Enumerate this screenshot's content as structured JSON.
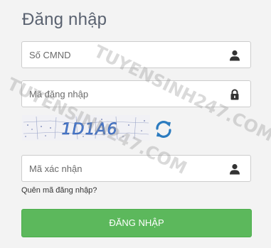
{
  "title": "Đăng nhập",
  "cmnd_field": {
    "placeholder": "Số CMND",
    "icon": "user-icon"
  },
  "password_field": {
    "placeholder": "Mã đăng nhập",
    "icon": "lock-icon"
  },
  "captcha": {
    "text": "1D1A6",
    "refresh_icon": "refresh-icon"
  },
  "captcha_field": {
    "placeholder": "Mã xác nhận",
    "icon": "user-icon"
  },
  "forgot_link": "Quên mã đăng nhập?",
  "login_button": "ĐĂNG NHẬP",
  "watermark": "TUYENSINH247.COM",
  "colors": {
    "button": "#5cb85c",
    "captcha_text": "#4e7ed0",
    "refresh": "#2b7bbf"
  }
}
